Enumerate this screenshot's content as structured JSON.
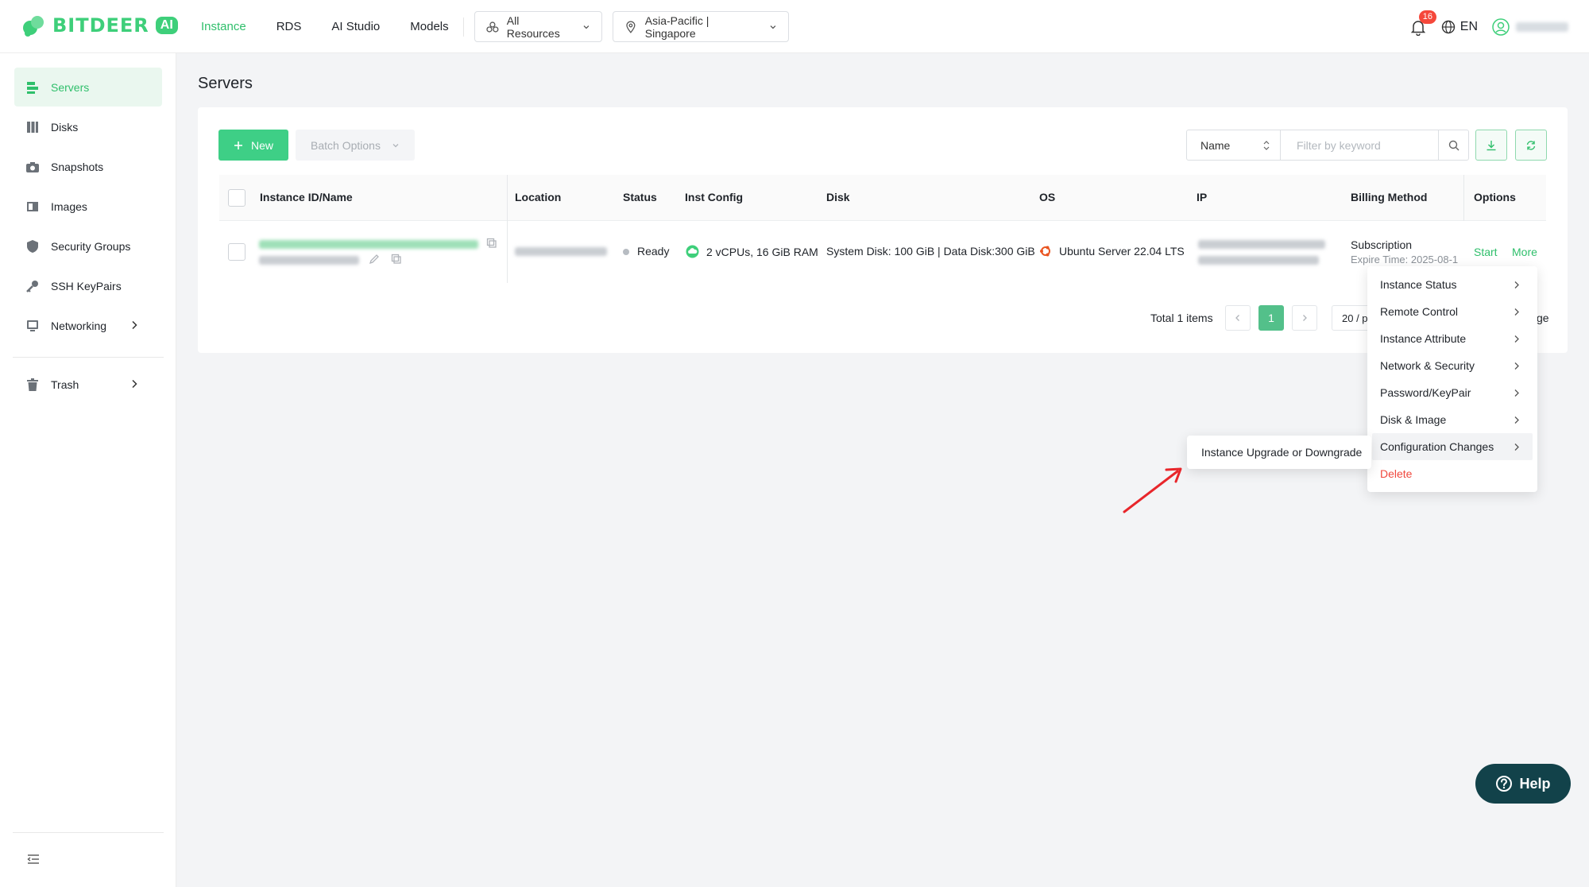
{
  "brand": {
    "name": "BITDEER",
    "suffix": "AI",
    "accent": "#3ecf7a"
  },
  "topnav": {
    "items": [
      "Instance",
      "RDS",
      "AI Studio",
      "Models"
    ],
    "active": "Instance",
    "resources_select": "All Resources",
    "region_select": "Asia-Pacific | Singapore"
  },
  "topright": {
    "notifications": "16",
    "language": "EN"
  },
  "sidebar": {
    "items": [
      "Servers",
      "Disks",
      "Snapshots",
      "Images",
      "Security Groups",
      "SSH KeyPairs",
      "Networking"
    ],
    "trash": "Trash",
    "active": "Servers"
  },
  "page": {
    "title": "Servers"
  },
  "toolbar": {
    "new_label": "New",
    "batch_label": "Batch Options",
    "search_type": "Name",
    "search_placeholder": "Filter by keyword"
  },
  "table": {
    "columns": [
      "Instance ID/Name",
      "Location",
      "Status",
      "Inst Config",
      "Disk",
      "OS",
      "IP",
      "Billing Method",
      "Options"
    ],
    "rows": [
      {
        "status": "Ready",
        "config": "2 vCPUs, 16 GiB RAM",
        "disk": "System Disk: 100 GiB | Data Disk:300 GiB",
        "os": "Ubuntu Server 22.04 LTS",
        "billing": "Subscription",
        "expire": "Expire Time: 2025-08-1",
        "action_start": "Start",
        "action_more": "More"
      }
    ]
  },
  "pagination": {
    "total": "Total 1 items",
    "current": "1",
    "page_size": "20 / p",
    "goto_suffix": "ge"
  },
  "more_menu": {
    "items": [
      "Instance Status",
      "Remote Control",
      "Instance Attribute",
      "Network & Security",
      "Password/KeyPair",
      "Disk & Image",
      "Configuration Changes"
    ],
    "delete": "Delete",
    "hovered": "Configuration Changes",
    "submenu_item": "Instance Upgrade or Downgrade"
  },
  "help": {
    "label": "Help"
  }
}
